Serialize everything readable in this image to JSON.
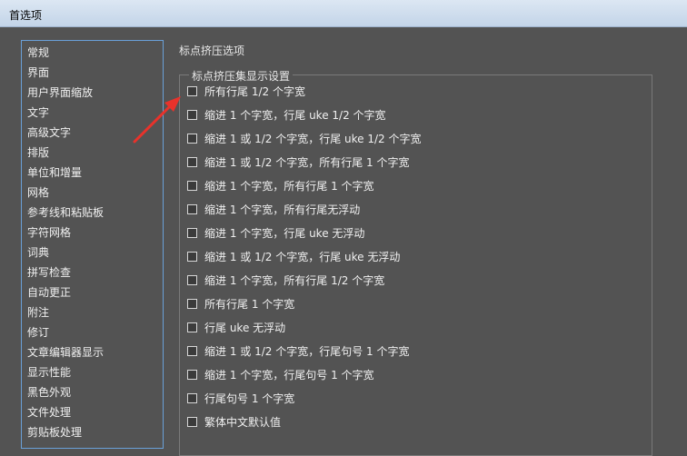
{
  "window": {
    "title": "首选项"
  },
  "sidebar": {
    "items": [
      "常规",
      "界面",
      "用户界面缩放",
      "文字",
      "高级文字",
      "排版",
      "单位和增量",
      "网格",
      "参考线和粘贴板",
      "字符网格",
      "词典",
      "拼写检查",
      "自动更正",
      "附注",
      "修订",
      "文章编辑器显示",
      "显示性能",
      "黑色外观",
      "文件处理",
      "剪贴板处理"
    ]
  },
  "main": {
    "section_title": "标点挤压选项",
    "group_title": "标点挤压集显示设置",
    "options": [
      "所有行尾 1/2 个字宽",
      "缩进 1 个字宽，行尾 uke 1/2 个字宽",
      "缩进 1 或 1/2 个字宽，行尾 uke 1/2 个字宽",
      "缩进 1 或 1/2 个字宽，所有行尾 1 个字宽",
      "缩进 1 个字宽，所有行尾 1 个字宽",
      "缩进 1 个字宽，所有行尾无浮动",
      "缩进 1 个字宽，行尾 uke 无浮动",
      "缩进 1 或 1/2 个字宽，行尾 uke 无浮动",
      "缩进 1 个字宽，所有行尾 1/2 个字宽",
      "所有行尾 1 个字宽",
      "行尾 uke 无浮动",
      "缩进 1 或 1/2 个字宽，行尾句号 1 个字宽",
      "缩进 1 个字宽，行尾句号 1 个字宽",
      "行尾句号 1 个字宽",
      "繁体中文默认值"
    ]
  },
  "colors": {
    "background": "#535353",
    "selection_border": "#6aa0d8",
    "arrow": "#e8322b"
  }
}
